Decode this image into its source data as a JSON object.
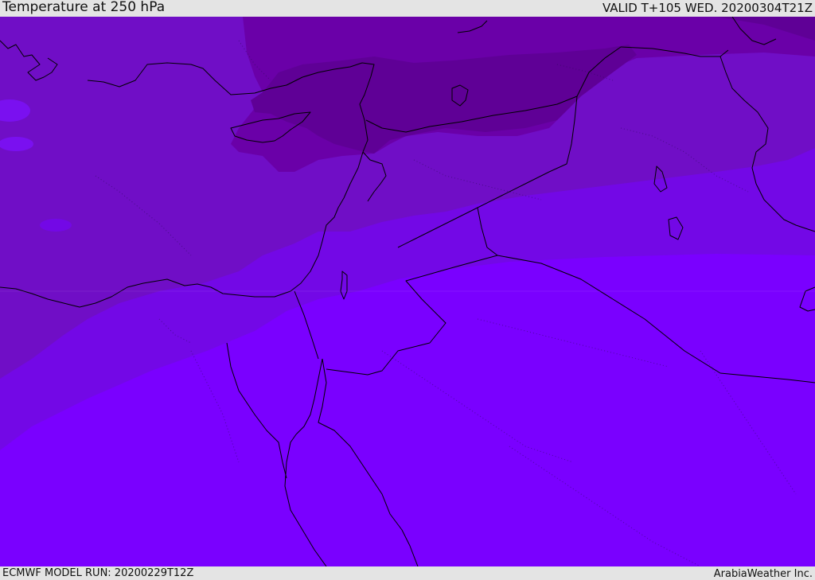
{
  "header": {
    "title": "Temperature at 250 hPa",
    "valid_time": "VALID T+105 WED. 20200304T21Z"
  },
  "footer": {
    "model_run": "ECMWF MODEL RUN: 20200229T12Z",
    "credit": "ArabiaWeather Inc."
  },
  "palette": {
    "warm_band": "#7a00ff",
    "mid_band": "#7308e6",
    "cool_band": "#700ec6",
    "cold_band": "#6a00a8",
    "coldest_band": "#5f0096",
    "coastline": "#000000"
  }
}
